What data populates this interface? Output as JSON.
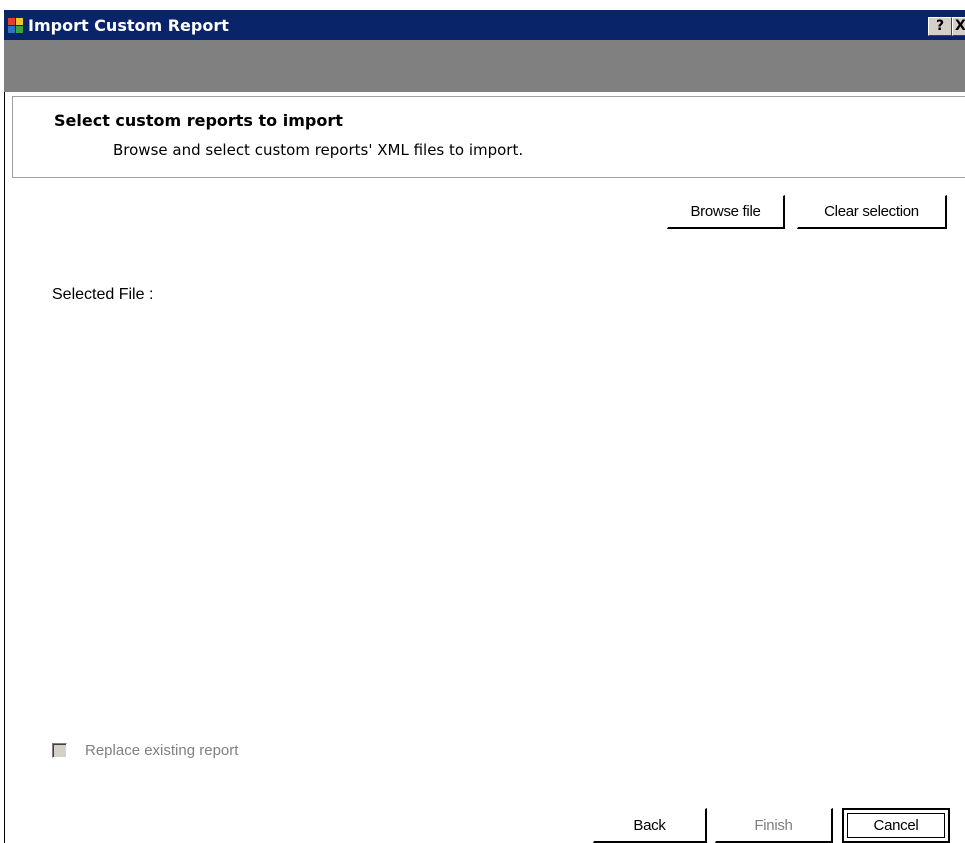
{
  "window": {
    "title": "Import Custom Report",
    "help_label": "?",
    "close_label": "X"
  },
  "header": {
    "title": "Select custom reports to import",
    "subtitle": "Browse and select custom reports' XML files to import."
  },
  "toolbar": {
    "browse_label": "Browse file",
    "clear_label": "Clear selection"
  },
  "body": {
    "selected_file_label": "Selected File :",
    "replace_label": "Replace existing report",
    "replace_checked": false,
    "replace_enabled": false
  },
  "footer": {
    "back_label": "Back",
    "finish_label": "Finish",
    "cancel_label": "Cancel"
  },
  "colors": {
    "titlebar": "#0a246a",
    "band": "#808080",
    "disabled_text": "#808080"
  },
  "icons": {
    "app": "app-window-icon",
    "help": "help-icon",
    "close": "close-icon"
  }
}
